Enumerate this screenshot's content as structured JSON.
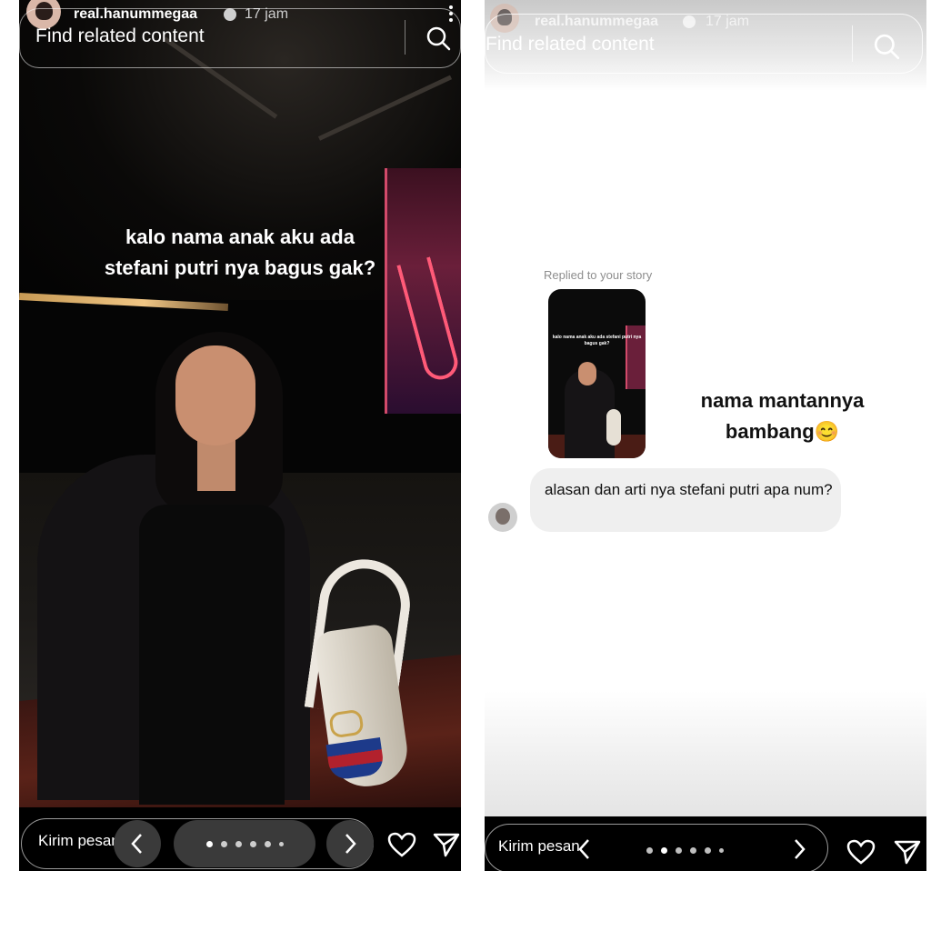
{
  "left_story": {
    "username": "real.hanummegaa",
    "time": "17 jam",
    "search_label": "Find related content",
    "story_text_line1": "kalo nama anak aku ada",
    "story_text_line2": "stefani putri nya bagus gak?",
    "message_placeholder": "Kirim pesan",
    "story_dots_total": 6,
    "story_dots_active_index": 0
  },
  "right_dm": {
    "username": "real.hanummegaa",
    "time": "17 jam",
    "search_label": "Find related content",
    "replied_label": "Replied to your story",
    "thumbnail_text": "kalo nama anak aku ada stefani putri nya bagus gak?",
    "reply_line1": "nama mantannya",
    "reply_line2": "bambang",
    "reply_emoji": "😊",
    "incoming_message": "alasan dan arti nya stefani putri apa num?",
    "message_placeholder": "Kirim pesan",
    "story_dots_total": 6,
    "story_dots_active_index": 1
  },
  "icons": {
    "search": "search-icon",
    "heart": "heart-icon",
    "send": "send-icon",
    "verified": "verified-badge-icon",
    "more": "more-options-icon",
    "prev": "chevron-left-icon",
    "next": "chevron-right-icon"
  },
  "colors": {
    "story_bg": "#050505",
    "dm_bg": "#ffffff",
    "bubble_bg": "#efefef",
    "text_dark": "#111111",
    "text_muted": "#8e8e8e"
  }
}
